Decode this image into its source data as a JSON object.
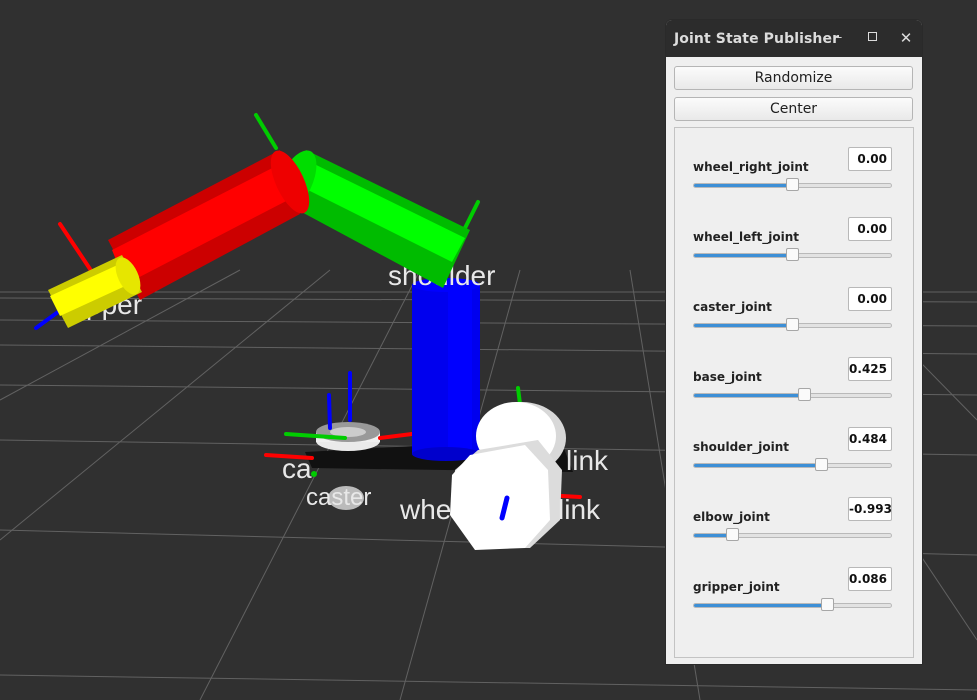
{
  "window": {
    "title": "Joint State Publisher",
    "minimize_glyph": "–",
    "close_glyph": "✕"
  },
  "buttons": {
    "randomize": "Randomize",
    "center": "Center"
  },
  "joints": [
    {
      "name": "wheel_right_joint",
      "value": "0.00",
      "position": 0.5
    },
    {
      "name": "wheel_left_joint",
      "value": "0.00",
      "position": 0.5
    },
    {
      "name": "caster_joint",
      "value": "0.00",
      "position": 0.5
    },
    {
      "name": "base_joint",
      "value": "0.425",
      "position": 0.565
    },
    {
      "name": "shoulder_joint",
      "value": "0.484",
      "position": 0.65
    },
    {
      "name": "elbow_joint",
      "value": "-0.993",
      "position": 0.2
    },
    {
      "name": "gripper_joint",
      "value": "0.086",
      "position": 0.68
    }
  ],
  "scene_labels": {
    "shoulder": "shoulder",
    "gripper_partial": "pper",
    "wheel_left_partial": "link",
    "wheel_right_partial_a": "whe",
    "wheel_right_partial_b": "link",
    "caster_partial_a": "ca",
    "caster_partial_b": "caster"
  },
  "colors": {
    "gripper": "#ffff00",
    "elbow_link": "#ff0000",
    "shoulder_link": "#00ff00",
    "base_column": "#0000ff",
    "wheels": "#ffffff",
    "background": "#303030",
    "slider_fill": "#3d8fd6"
  }
}
